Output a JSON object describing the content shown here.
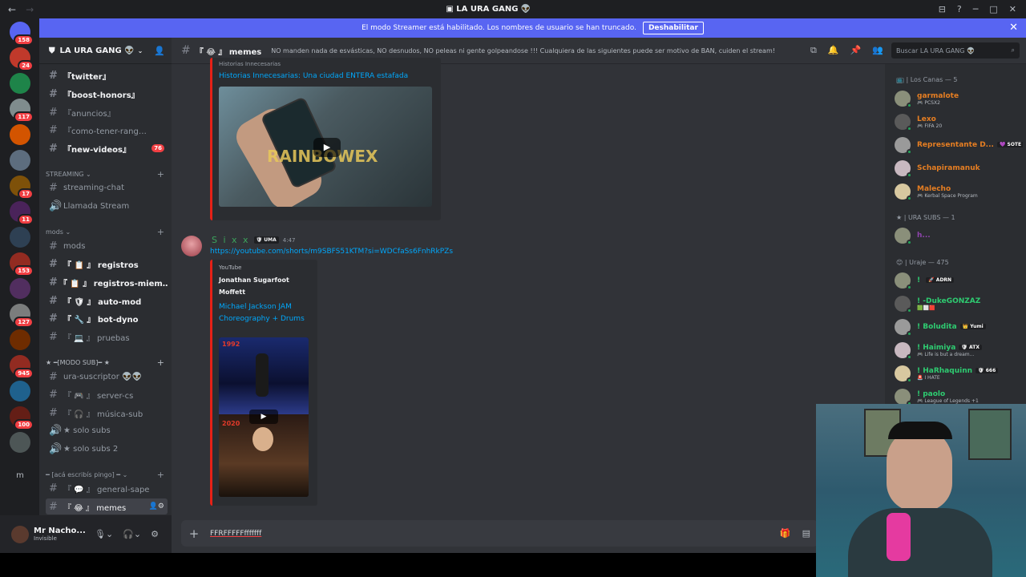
{
  "titlebar": {
    "title": "LA URA GANG 👽"
  },
  "banner": {
    "text": "El modo Streamer está habilitado. Los nombres de usuario se han truncado.",
    "button": "Deshabilitar"
  },
  "guilds": [
    {
      "badge": "158"
    },
    {
      "badge": "24"
    },
    {
      "badge": ""
    },
    {
      "badge": "117"
    },
    {
      "badge": ""
    },
    {
      "badge": ""
    },
    {
      "badge": "17"
    },
    {
      "badge": "11"
    },
    {
      "badge": ""
    },
    {
      "badge": "153"
    },
    {
      "badge": ""
    },
    {
      "badge": "127"
    },
    {
      "badge": ""
    },
    {
      "badge": "945"
    },
    {
      "badge": ""
    },
    {
      "badge": "100"
    },
    {
      "badge": ""
    }
  ],
  "server": {
    "name": "LA URA GANG 👽"
  },
  "channels": {
    "twitter": "『twitter』",
    "boost": "『boost-honors』",
    "anuncios": "『anuncios』",
    "rango": "『como-tener-rang…",
    "videos": "『new-videos』",
    "videos_count": "76",
    "cat_streaming": "STREAMING",
    "streaming_chat": "streaming-chat",
    "llamada": "Llamada Stream",
    "cat_mods": "mods",
    "mods": "mods",
    "registros": "『 📋 』 registros",
    "registros_miem": "『 📋 』 registros-miem…",
    "automod": "『 🛡 』 auto-mod",
    "botdyno": "『 🔧 』 bot-dyno",
    "pruebas": "『 💻 』 pruebas",
    "cat_modosub": "★ ━[MODO SUB]━ ★",
    "ura_sus": "ura-suscriptor 👽👽",
    "server_cs": "『 🎮 』 server-cs",
    "musica": "『 🎧 』 música-sub",
    "solo1": "★ solo subs",
    "solo2": "★ solo subs 2",
    "cat_aca": "━ [acá escribís pingo] ━",
    "general": "『 💬 』 general-sape",
    "memes": "『 😂 』 memes"
  },
  "user": {
    "name": "Mr Nacho...",
    "status": "Invisible"
  },
  "header": {
    "channel": "『 😂 』 memes",
    "topic": "NO manden nada de esvásticas, NO desnudos, NO peleas ni gente golpeandose !!! Cualquiera de las siguientes puede ser motivo de BAN, cuiden el stream!",
    "search": "Buscar LA URA GANG 👽"
  },
  "embed1": {
    "provider": "Historias Innecesarias",
    "title": "Historias Innecesarias: Una ciudad ENTERA estafada",
    "thumb_text": "RAINBOWEX"
  },
  "message": {
    "author": "S i x x",
    "tag": "🛡 UMA",
    "time": "4:47",
    "link": "https://youtube.com/shorts/m9SBFS51KTM?si=WDCfaSs6FnhRkPZs"
  },
  "embed2": {
    "provider": "YouTube",
    "author_line1": "Jonathan Sugarfoot",
    "author_line2": "Moffett",
    "title_line1": "Michael Jackson JAM",
    "title_line2": "Choreography + Drums",
    "year1": "1992",
    "year2": "2020"
  },
  "composer": {
    "text": "FFRFFFFFfffffff"
  },
  "members": {
    "cat_canas": "📺 | Los Canas — 5",
    "canas": [
      {
        "name": "garmalote",
        "sub": "🎮 PCSX2",
        "color": "#e67e22"
      },
      {
        "name": "Lexo",
        "sub": "🎮 FIFA 20",
        "color": "#e67e22"
      },
      {
        "name": "Representante D...",
        "sub": "",
        "color": "#e67e22",
        "tag": "💜 SOTE"
      },
      {
        "name": "Schapiramanuk",
        "sub": "",
        "color": "#e67e22"
      },
      {
        "name": "Malecho",
        "sub": "🎮 Kerbal Space Program",
        "color": "#e67e22"
      }
    ],
    "cat_subs": "★ | URA SUBS — 1",
    "subs": [
      {
        "name": "h...",
        "sub": "",
        "color": "#8e44ad"
      }
    ],
    "cat_uraje": "😊 | Uraje — 475",
    "uraje": [
      {
        "name": "! ",
        "sub": "",
        "color": "#2ecc71",
        "tag": "🚀 ADRN"
      },
      {
        "name": "! -DukeGONZAZ",
        "sub": "🟩⬜🟥",
        "color": "#2ecc71"
      },
      {
        "name": "! Boludita",
        "sub": "",
        "color": "#2ecc71",
        "tag": "👑 Yumi"
      },
      {
        "name": "! Haimiya",
        "sub": "🎮 Life is but a dream...",
        "color": "#2ecc71",
        "tag": "🛡 ATX"
      },
      {
        "name": "! HaRhaquinn",
        "sub": "🚨 I HATE",
        "color": "#2ecc71",
        "tag": "🛡 666"
      },
      {
        "name": "! paolo",
        "sub": "🎮 League of Legends +1",
        "color": "#2ecc71"
      }
    ]
  }
}
